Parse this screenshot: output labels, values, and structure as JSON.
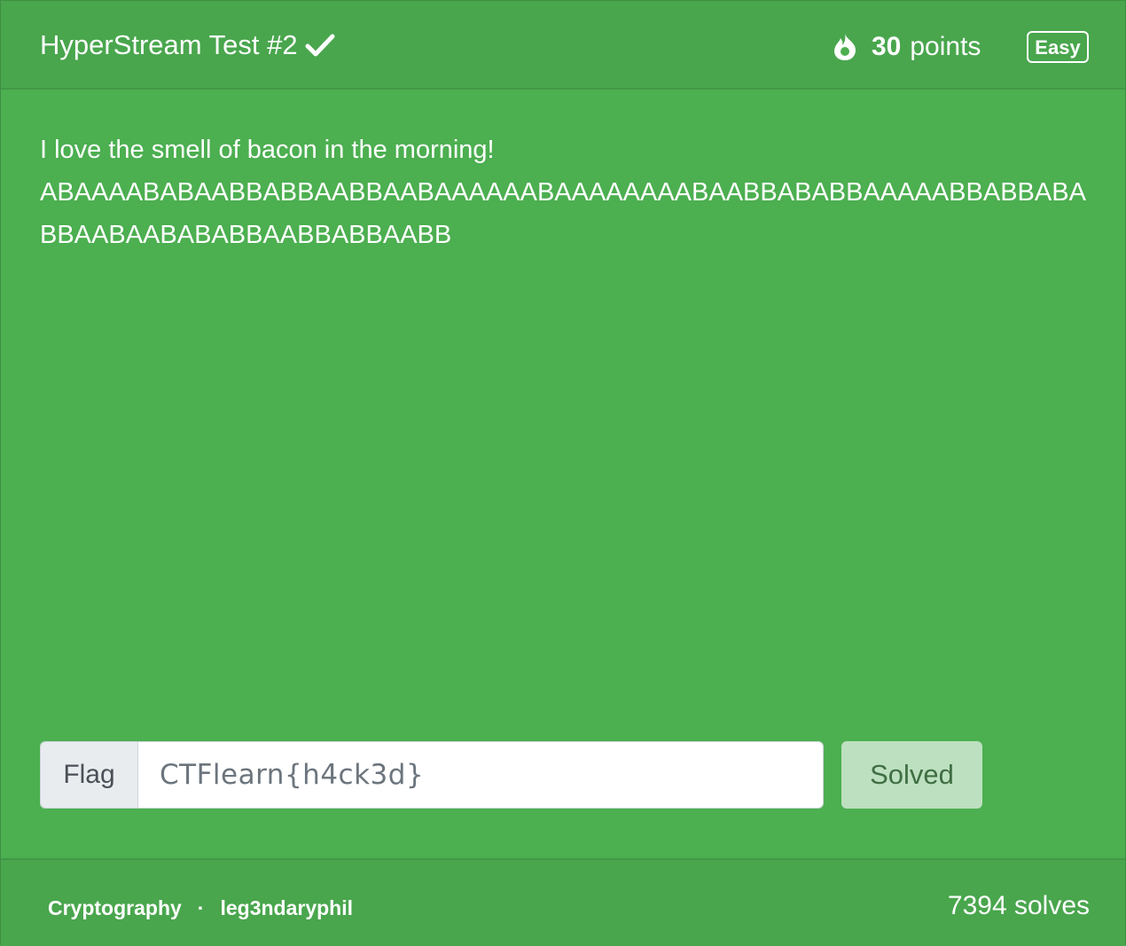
{
  "challenge": {
    "title": "HyperStream Test #2",
    "solved_icon": "check-icon",
    "points_icon": "fire-icon",
    "points_value": "30",
    "points_label": "points",
    "difficulty": "Easy"
  },
  "body": {
    "line1": "I love the smell of bacon in the morning!",
    "cipher": "ABAAAABABAABBABBAABBAABAAAAAABAAAAAAAABAABBABABBAAAAABBABBABABBAABAABABABBAABBABBAABB"
  },
  "flag": {
    "label": "Flag",
    "value": "CTFlearn{h4ck3d}",
    "button_label": "Solved"
  },
  "footer": {
    "category": "Cryptography",
    "separator": "·",
    "author": "leg3ndaryphil",
    "solves": "7394 solves"
  },
  "colors": {
    "card_bg": "#4caf50",
    "header_bg": "#49a64d",
    "solved_button_bg": "#bde0c0"
  }
}
